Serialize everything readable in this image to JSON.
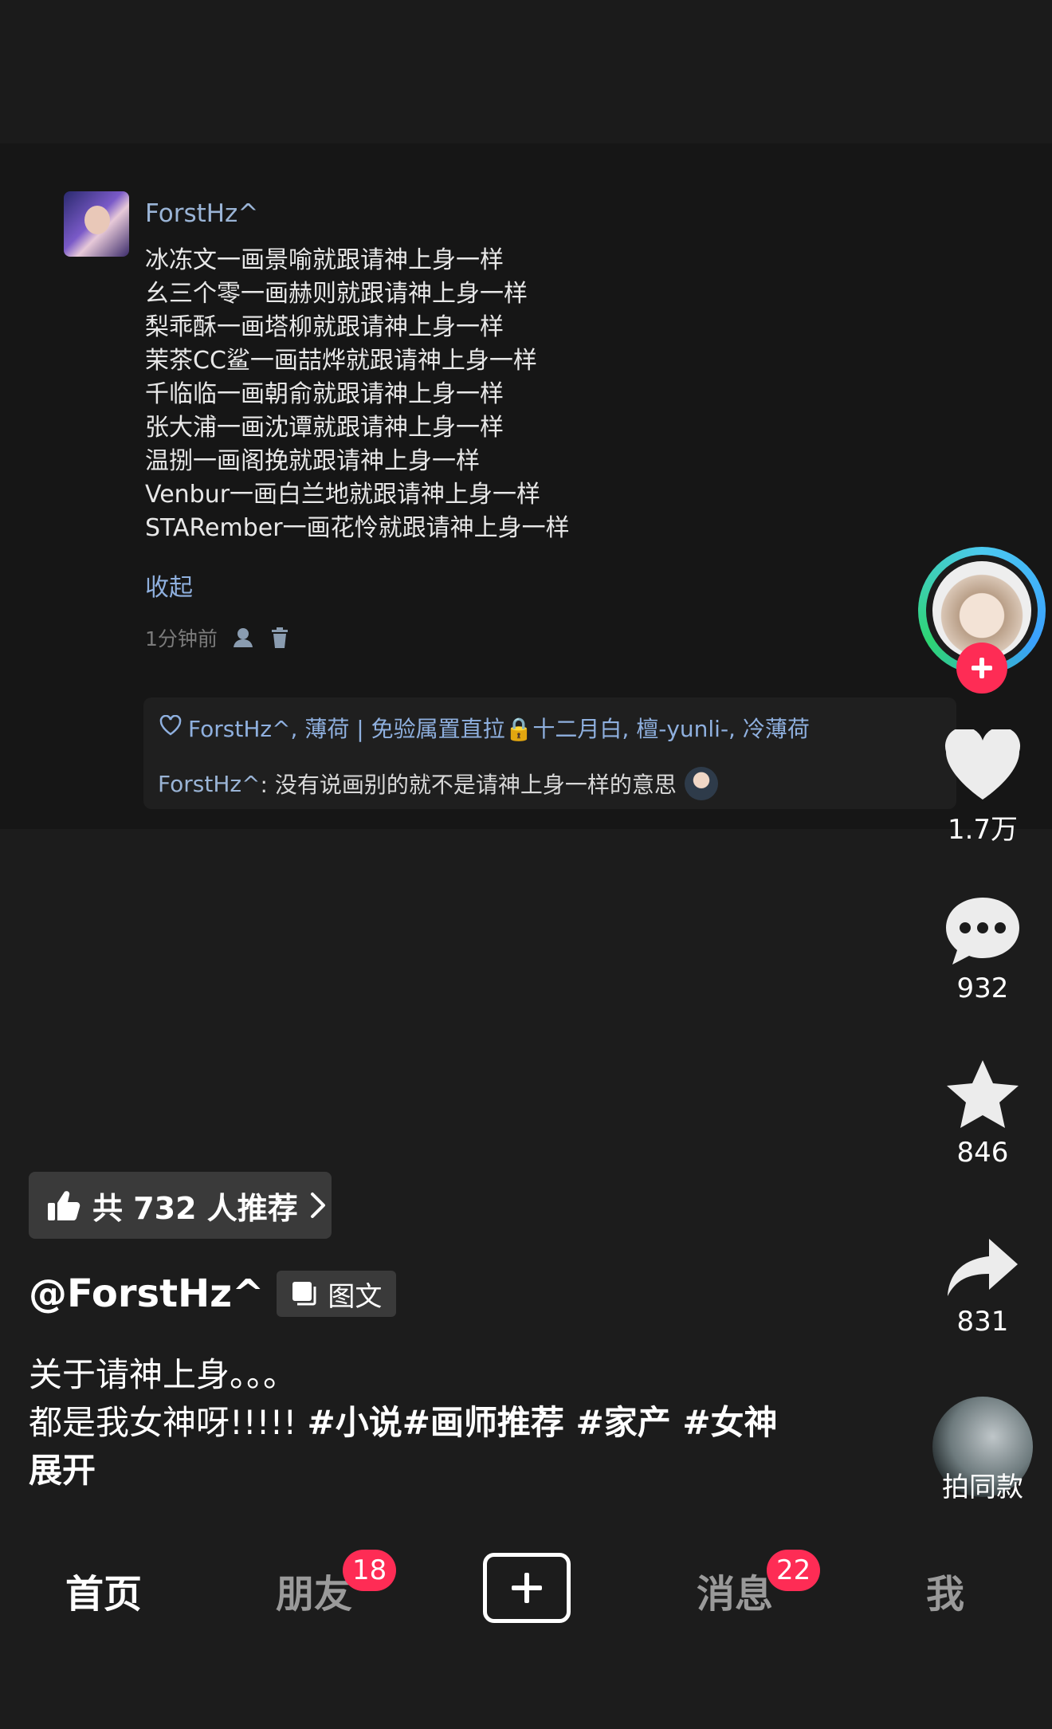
{
  "comment": {
    "username": "ForstHz^",
    "lines": [
      "冰冻文一画景喻就跟请神上身一样",
      "幺三个零一画赫则就跟请神上身一样",
      "梨乖酥一画塔柳就跟请神上身一样",
      "茉茶CC鲨一画喆烨就跟请神上身一样",
      "千临临一画朝俞就跟请神上身一样",
      "张大浦一画沈谭就跟请神上身一样",
      "温捌一画阁挽就跟请神上身一样",
      "Venbur一画白兰地就跟请神上身一样",
      "STARember一画花怜就跟请神上身一样"
    ],
    "collapse_label": "收起",
    "time": "1分钟前",
    "liked_by": "ForstHz^, 薄荷 | 免验属置直拉🔒十二月白, 檀-yunli-, 冷薄荷",
    "reply_user": "ForstHz^",
    "reply_text": ": 没有说画别的就不是请神上身一样的意思"
  },
  "rail": {
    "likes": "1.7万",
    "comments": "932",
    "favorites": "846",
    "shares": "831",
    "music_label": "拍同款"
  },
  "recommend": {
    "label": "共 732 人推荐"
  },
  "post": {
    "author": "@ForstHz^",
    "type_label": "图文",
    "line1": "关于请神上身。。。",
    "line2_text": "都是我女神呀!!!!! ",
    "tags": "#小说#画师推荐 #家产 #女神",
    "expand": "展开"
  },
  "nav": {
    "home": "首页",
    "friends": "朋友",
    "friends_badge": "18",
    "messages": "消息",
    "messages_badge": "22",
    "me": "我"
  }
}
